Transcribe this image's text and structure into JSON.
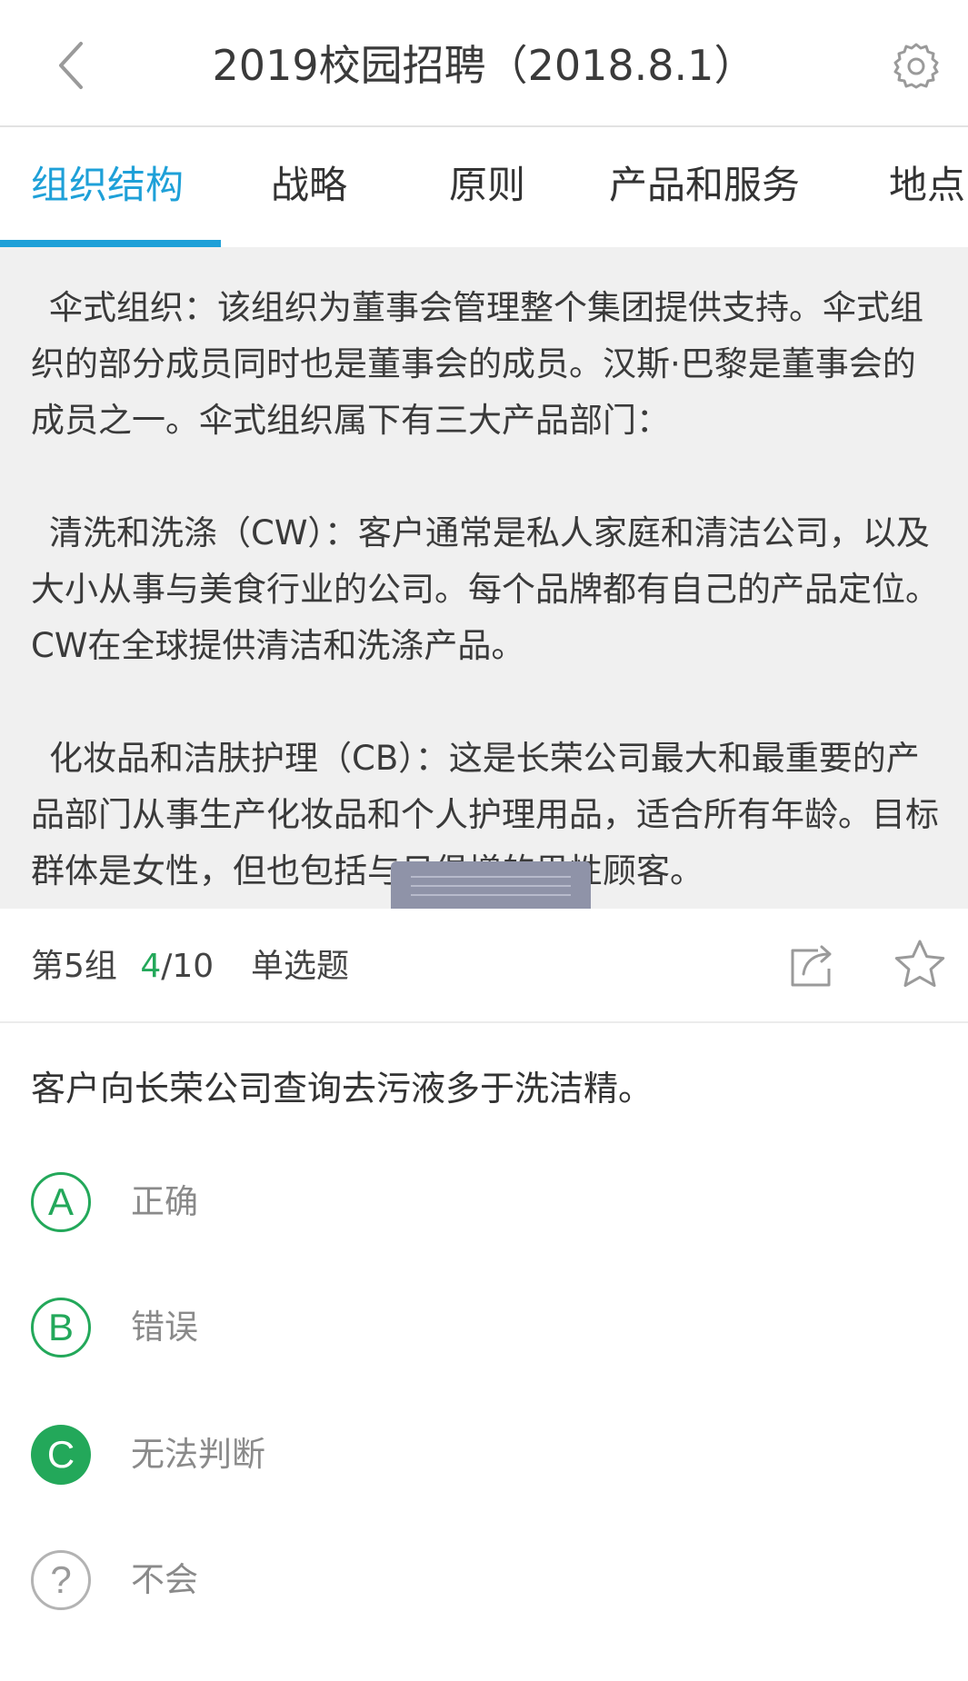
{
  "header": {
    "title": "2019校园招聘（2018.8.1）"
  },
  "tabs": [
    {
      "label": "组织结构",
      "active": true
    },
    {
      "label": "战略",
      "active": false
    },
    {
      "label": "原则",
      "active": false
    },
    {
      "label": "产品和服务",
      "active": false
    },
    {
      "label": "地点",
      "active": false
    }
  ],
  "passage": {
    "paragraphs": [
      "伞式组织：该组织为董事会管理整个集团提供支持。伞式组织的部分成员同时也是董事会的成员。汉斯·巴黎是董事会的成员之一。伞式组织属下有三大产品部门：",
      "清洗和洗涤（CW）：客户通常是私人家庭和清洁公司，以及大小从事与美食行业的公司。每个品牌都有自己的产品定位。CW在全球提供清洁和洗涤产品。",
      "化妆品和洁肤护理（CB）：这是长荣公司最大和最重要的产品部门从事生产化妆品和个人护理用品，适合所有年龄。目标群体是女性，但也包括与日俱增的男性顾客。"
    ]
  },
  "question_bar": {
    "group": "第5组",
    "current": "4",
    "total": "/10",
    "type": "单选题"
  },
  "question": {
    "text": "客户向长荣公司查询去污液多于洗洁精。"
  },
  "options": [
    {
      "letter": "A",
      "label": "正确",
      "selected": false
    },
    {
      "letter": "B",
      "label": "错误",
      "selected": false
    },
    {
      "letter": "C",
      "label": "无法判断",
      "selected": true
    },
    {
      "letter": "?",
      "label": "不会",
      "selected": false
    }
  ],
  "colors": {
    "accent_blue": "#1ea0d8",
    "accent_green": "#23a85a",
    "passage_bg": "#f0f0f0"
  },
  "icons": {
    "back": "chevron-left-icon",
    "settings": "gear-icon",
    "share": "share-icon",
    "favorite": "star-icon"
  }
}
